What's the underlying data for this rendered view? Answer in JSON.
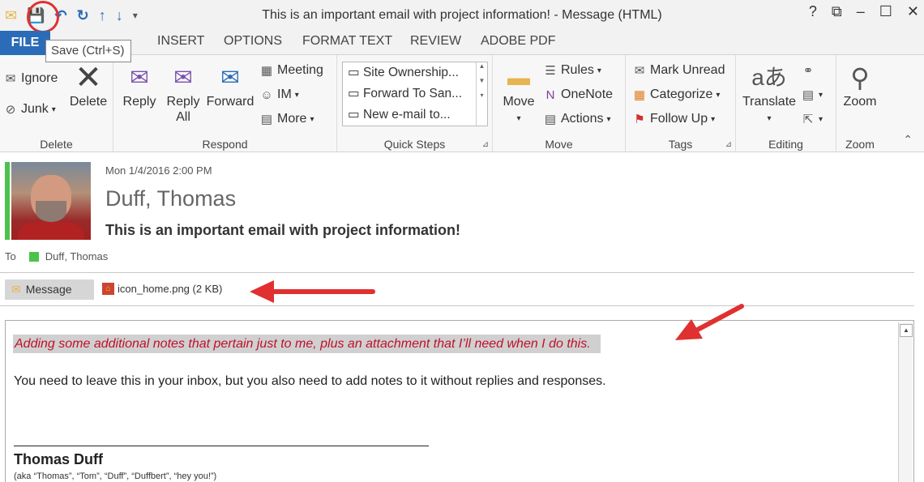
{
  "window": {
    "title": "This is an important email with project information! - Message (HTML)",
    "controls": [
      "?",
      "⧉",
      "–",
      "☐",
      "✕"
    ]
  },
  "qat": {
    "tooltip": "Save (Ctrl+S)"
  },
  "tabs": {
    "file": "FILE",
    "insert": "INSERT",
    "options": "OPTIONS",
    "format_text": "FORMAT TEXT",
    "review": "REVIEW",
    "adobe_pdf": "ADOBE PDF"
  },
  "ribbon": {
    "delete_group": {
      "label": "Delete",
      "ignore": "Ignore",
      "junk": "Junk",
      "delete": "Delete"
    },
    "respond_group": {
      "label": "Respond",
      "reply": "Reply",
      "reply_all_line1": "Reply",
      "reply_all_line2": "All",
      "forward": "Forward",
      "meeting": "Meeting",
      "im": "IM",
      "more": "More"
    },
    "quick_steps": {
      "label": "Quick Steps",
      "items": [
        "Site Ownership...",
        "Forward To San...",
        "New e-mail to..."
      ]
    },
    "move_group": {
      "label": "Move",
      "move": "Move",
      "rules": "Rules",
      "onenote": "OneNote",
      "actions": "Actions"
    },
    "tags_group": {
      "label": "Tags",
      "mark_unread": "Mark Unread",
      "categorize": "Categorize",
      "follow_up": "Follow Up"
    },
    "editing_group": {
      "label": "Editing",
      "translate": "Translate"
    },
    "zoom_group": {
      "label": "Zoom",
      "zoom": "Zoom"
    }
  },
  "message": {
    "date": "Mon 1/4/2016 2:00 PM",
    "from": "Duff, Thomas",
    "subject": "This is an important email with project information!",
    "to_label": "To",
    "to_value": "Duff, Thomas"
  },
  "attachments": {
    "message_tab": "Message",
    "file": "icon_home.png (2 KB)"
  },
  "body": {
    "note": "Adding some additional notes that pertain just to me, plus an attachment that I’ll need when I do this.",
    "paragraph": "You need to leave this in your inbox, but you also need to add notes to it without replies and responses.",
    "signature_name": "Thomas Duff",
    "signature_aka": "(aka “Thomas”, “Tom”, “Duff”, “Duffbert”, “hey you!”)"
  },
  "colors": {
    "accent": "#2b6cb8",
    "annotation_red": "#e03030",
    "note_red": "#c0102a",
    "presence_green": "#4cc24c"
  }
}
